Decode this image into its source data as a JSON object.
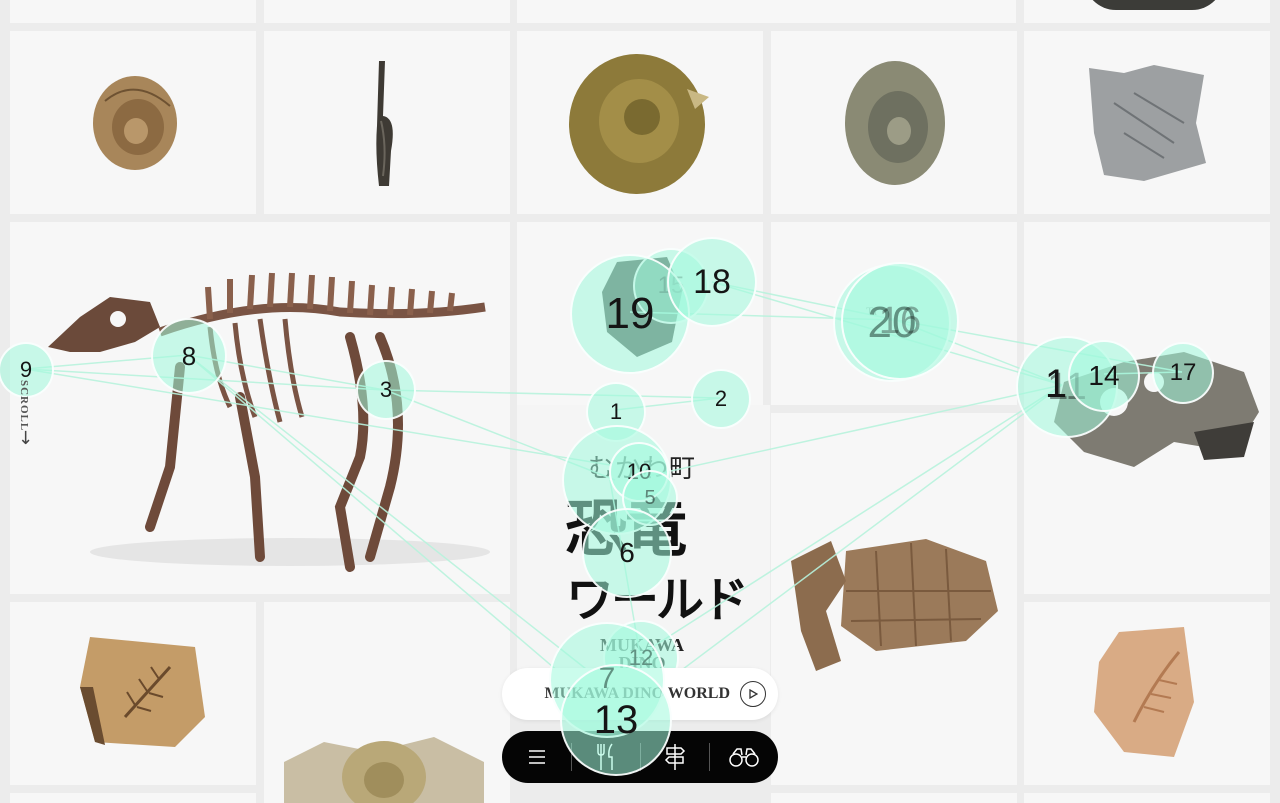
{
  "nav": {
    "scroll_label": "SCROLL",
    "world_button_label": "MUKAWA DINO WORLD",
    "tools": [
      {
        "name": "menu-icon"
      },
      {
        "name": "restaurant-icon"
      },
      {
        "name": "signpost-icon"
      },
      {
        "name": "binoculars-icon"
      }
    ]
  },
  "logo": {
    "kana": "むかわ町",
    "kanji": "恐竜",
    "world": "ワールド",
    "en_line1": "MUKAWA",
    "en_line2": "DINO WORLD"
  },
  "bubbles": [
    {
      "label": "1"
    },
    {
      "label": "2"
    },
    {
      "label": "3"
    },
    {
      "label": "5"
    },
    {
      "label": "6"
    },
    {
      "label": "7"
    },
    {
      "label": "8"
    },
    {
      "label": "9"
    },
    {
      "label": "10"
    },
    {
      "label": "11"
    },
    {
      "label": "12"
    },
    {
      "label": "13"
    },
    {
      "label": "14"
    },
    {
      "label": "15"
    },
    {
      "label": "16"
    },
    {
      "label": "17"
    },
    {
      "label": "18"
    },
    {
      "label": "19"
    },
    {
      "label": "20"
    },
    {
      "label": "1"
    }
  ],
  "colors": {
    "bubble": "#a0fadc",
    "line": "#b8f3dd",
    "toolbar": "#050505"
  }
}
